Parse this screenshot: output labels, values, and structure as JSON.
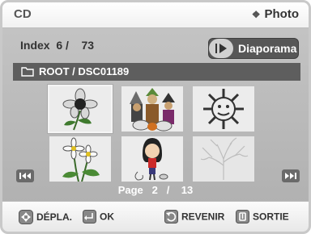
{
  "header": {
    "source": "CD",
    "mode": "Photo",
    "mode_icon": "diamond-icon"
  },
  "index": {
    "label": "Index",
    "current": "6",
    "separator": "/",
    "total": "73"
  },
  "slideshow_button": {
    "label": "Diaporama"
  },
  "path": {
    "text": "ROOT / DSC01189"
  },
  "thumbnails": [
    {
      "subject": "flower",
      "selected": true
    },
    {
      "subject": "halloween-figures",
      "selected": false
    },
    {
      "subject": "sun",
      "selected": false
    },
    {
      "subject": "daisies",
      "selected": false
    },
    {
      "subject": "girl-cartoon",
      "selected": false
    },
    {
      "subject": "tree-sketch",
      "selected": false
    }
  ],
  "pagination": {
    "label": "Page",
    "current": "2",
    "separator": "/",
    "total": "13"
  },
  "footer": {
    "move_label": "DÉPLA.",
    "ok_label": "OK",
    "return_label": "REVENIR",
    "exit_label": "SORTIE"
  },
  "colors": {
    "panel": "#b8b8b8",
    "bar": "#5e5e5e",
    "thumb_bg": "#ececec"
  }
}
